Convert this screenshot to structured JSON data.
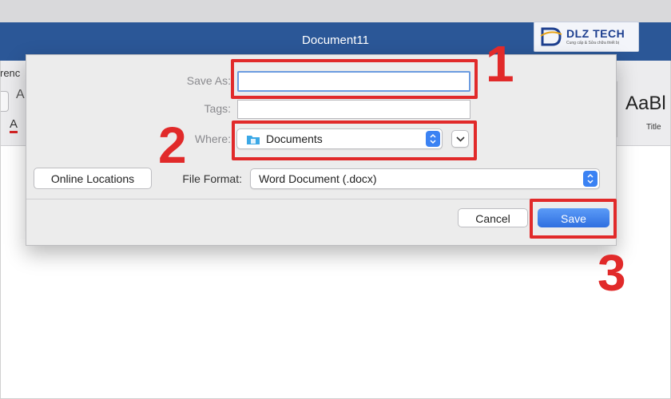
{
  "window": {
    "title": "Document11"
  },
  "watermark": {
    "brand": "DLZ TECH",
    "tagline": "Cung cấp & Sửa chữa thiết bị"
  },
  "ribbon": {
    "tab_partial": "renc",
    "font_color_label": "A",
    "style_sample": "AaBl",
    "style_name": "Title"
  },
  "dialog": {
    "save_as_label": "Save As:",
    "save_as_value": "",
    "tags_label": "Tags:",
    "tags_value": "",
    "where_label": "Where:",
    "where_value": "Documents",
    "online_locations_label": "Online Locations",
    "file_format_label": "File Format:",
    "file_format_value": "Word Document (.docx)",
    "cancel_label": "Cancel",
    "save_label": "Save"
  },
  "annotations": {
    "step1": "1",
    "step2": "2",
    "step3": "3"
  },
  "colors": {
    "titlebar": "#2b5797",
    "accent_blue": "#3b82f3",
    "annotation_red": "#e12a2a"
  }
}
